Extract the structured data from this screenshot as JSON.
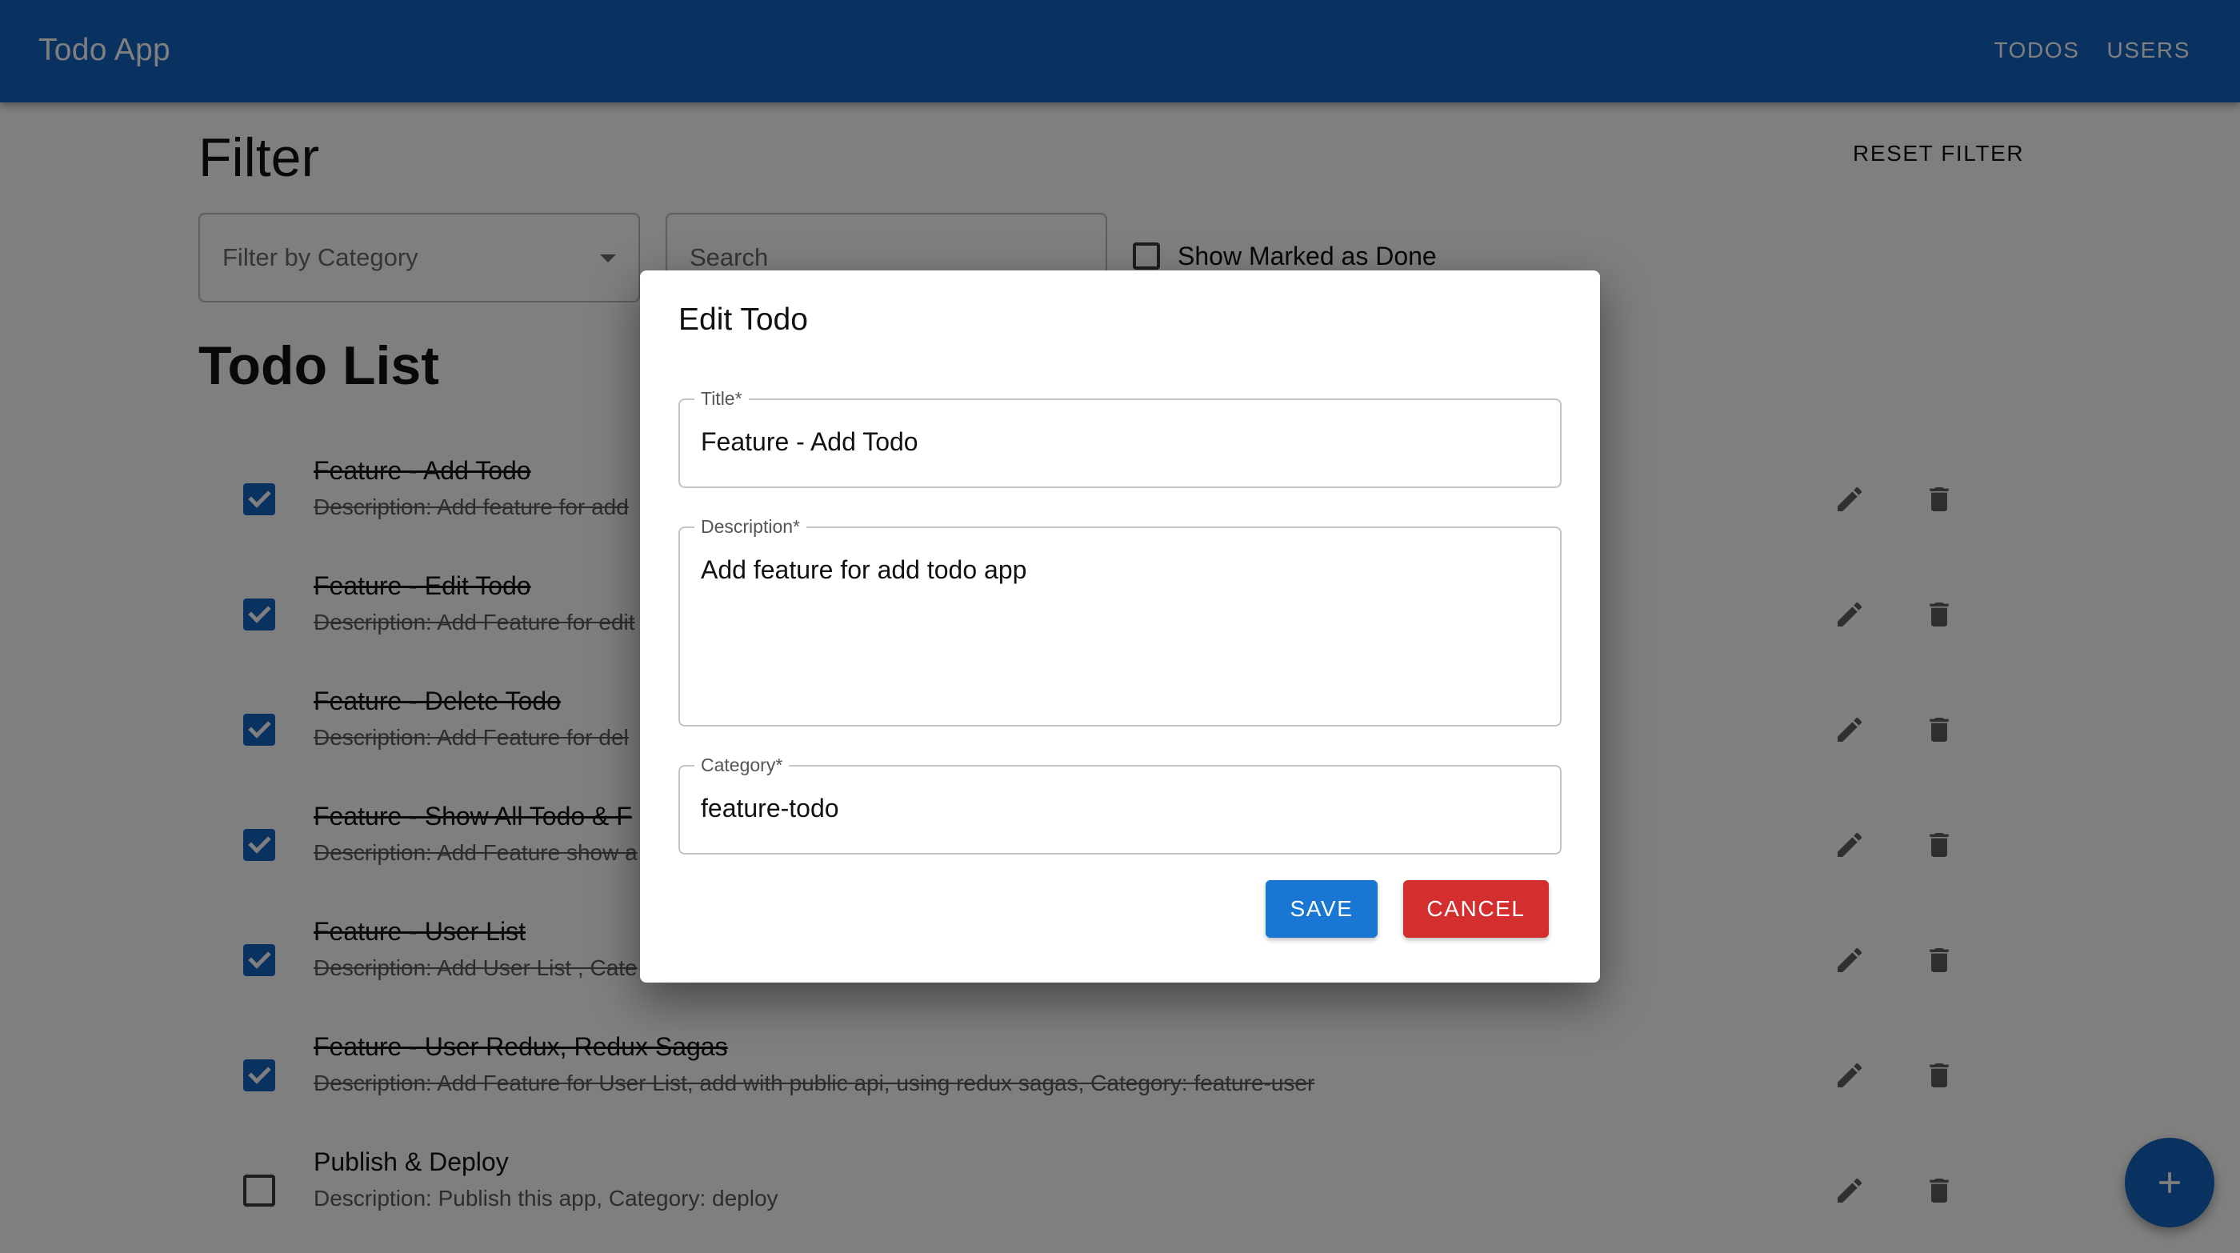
{
  "app": {
    "title": "Todo App"
  },
  "nav": {
    "todos": "TODOS",
    "users": "USERS"
  },
  "filter": {
    "heading": "Filter",
    "reset_label": "RESET FILTER",
    "category_placeholder": "Filter by Category",
    "search_placeholder": "Search",
    "show_done_label": "Show Marked as Done",
    "show_done_checked": false
  },
  "todo_list": {
    "heading": "Todo List",
    "items": [
      {
        "title": "Feature - Add Todo",
        "description": "Description: Add feature for add",
        "done": true
      },
      {
        "title": "Feature - Edit Todo",
        "description": "Description: Add Feature for edit",
        "done": true
      },
      {
        "title": "Feature - Delete Todo",
        "description": "Description: Add Feature for del",
        "done": true
      },
      {
        "title": "Feature - Show All Todo & F",
        "description": "Description: Add Feature show a",
        "done": true
      },
      {
        "title": "Feature - User List",
        "description": "Description: Add User List , Cate",
        "done": true
      },
      {
        "title": "Feature - User Redux, Redux Sagas",
        "description": "Description: Add Feature for User List, add with public api, using redux sagas, Category: feature-user",
        "done": true
      },
      {
        "title": "Publish & Deploy",
        "description": "Description: Publish this app, Category: deploy",
        "done": false
      }
    ]
  },
  "dialog": {
    "title": "Edit Todo",
    "fields": {
      "title": {
        "label": "Title",
        "value": "Feature - Add Todo"
      },
      "description": {
        "label": "Description",
        "value": "Add feature for add todo app"
      },
      "category": {
        "label": "Category",
        "value": "feature-todo"
      }
    },
    "required_mark": "*",
    "save_label": "SAVE",
    "cancel_label": "CANCEL"
  },
  "icons": {
    "edit": "pencil-icon",
    "delete": "trash-icon",
    "add": "plus-icon",
    "dropdown": "caret-down-icon"
  },
  "colors": {
    "primary": "#1565c0",
    "save": "#1976d2",
    "cancel": "#d32f2f"
  }
}
